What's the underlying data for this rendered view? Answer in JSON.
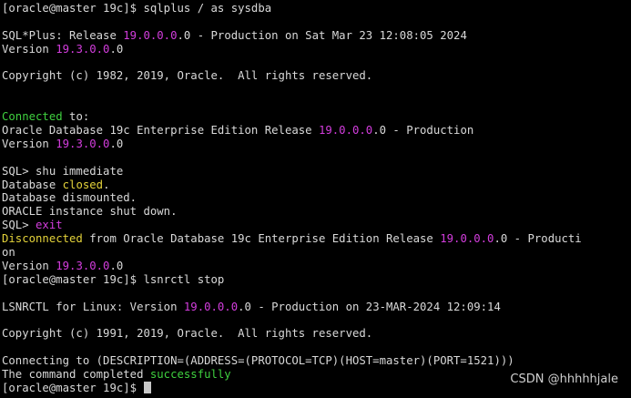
{
  "colors": {
    "background": "#000000",
    "default": "#d9d9d9",
    "magenta": "#d33ddd",
    "yellow": "#e3d23a",
    "green": "#3fd03f",
    "cursor": "#c8c8c8"
  },
  "watermark": "CSDN @hhhhhjale",
  "lines": [
    [
      {
        "t": "[oracle@master 19c]$ sqlplus / as sysdba",
        "c": "default"
      }
    ],
    [],
    [
      {
        "t": "SQL*Plus: Release ",
        "c": "default"
      },
      {
        "t": "19.0.0.0",
        "c": "magenta"
      },
      {
        "t": ".0 - Production on Sat Mar 23 12:08:05 2024",
        "c": "default"
      }
    ],
    [
      {
        "t": "Version ",
        "c": "default"
      },
      {
        "t": "19.3.0.0",
        "c": "magenta"
      },
      {
        "t": ".0",
        "c": "default"
      }
    ],
    [],
    [
      {
        "t": "Copyright (c) 1982, 2019, Oracle.  All rights reserved.",
        "c": "default"
      }
    ],
    [],
    [],
    [
      {
        "t": "Connected",
        "c": "green"
      },
      {
        "t": " to:",
        "c": "default"
      }
    ],
    [
      {
        "t": "Oracle Database 19c Enterprise Edition Release ",
        "c": "default"
      },
      {
        "t": "19.0.0.0",
        "c": "magenta"
      },
      {
        "t": ".0 - Production",
        "c": "default"
      }
    ],
    [
      {
        "t": "Version ",
        "c": "default"
      },
      {
        "t": "19.3.0.0",
        "c": "magenta"
      },
      {
        "t": ".0",
        "c": "default"
      }
    ],
    [],
    [
      {
        "t": "SQL> shu immediate",
        "c": "default"
      }
    ],
    [
      {
        "t": "Database ",
        "c": "default"
      },
      {
        "t": "closed",
        "c": "yellow"
      },
      {
        "t": ".",
        "c": "default"
      }
    ],
    [
      {
        "t": "Database dismounted.",
        "c": "default"
      }
    ],
    [
      {
        "t": "ORACLE instance shut down.",
        "c": "default"
      }
    ],
    [
      {
        "t": "SQL> ",
        "c": "default"
      },
      {
        "t": "exit",
        "c": "magenta"
      }
    ],
    [
      {
        "t": "Disconnected",
        "c": "yellow"
      },
      {
        "t": " from Oracle Database 19c Enterprise Edition Release ",
        "c": "default"
      },
      {
        "t": "19.0.0.0",
        "c": "magenta"
      },
      {
        "t": ".0 - Producti",
        "c": "default"
      }
    ],
    [
      {
        "t": "on",
        "c": "default"
      }
    ],
    [
      {
        "t": "Version ",
        "c": "default"
      },
      {
        "t": "19.3.0.0",
        "c": "magenta"
      },
      {
        "t": ".0",
        "c": "default"
      }
    ],
    [
      {
        "t": "[oracle@master 19c]$ lsnrctl stop",
        "c": "default"
      }
    ],
    [],
    [
      {
        "t": "LSNRCTL for Linux: Version ",
        "c": "default"
      },
      {
        "t": "19.0.0.0",
        "c": "magenta"
      },
      {
        "t": ".0 - Production on 23-MAR-2024 12:09:14",
        "c": "default"
      }
    ],
    [],
    [
      {
        "t": "Copyright (c) 1991, 2019, Oracle.  All rights reserved.",
        "c": "default"
      }
    ],
    [],
    [
      {
        "t": "Connecting to (DESCRIPTION=(ADDRESS=(PROTOCOL=TCP)(HOST=master)(PORT=1521)))",
        "c": "default"
      }
    ],
    [
      {
        "t": "The command completed ",
        "c": "default"
      },
      {
        "t": "successfully",
        "c": "green"
      }
    ],
    [
      {
        "t": "[oracle@master 19c]$ ",
        "c": "default"
      }
    ]
  ]
}
